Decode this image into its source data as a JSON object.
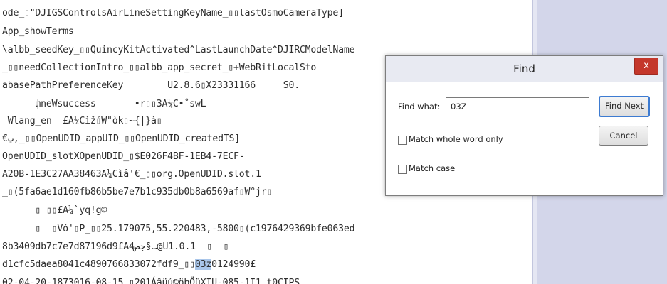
{
  "editor": {
    "lines": [
      "ode_▯\"DJIGSControlsAirLineSettingKeyName_▯▯lastOsmoCameraType]",
      "App_showTerms",
      "\\albb_seedKey_▯▯QuincyKitActivated^LastLaunchDate^DJIRCModelName",
      "_▯▯needCollectionIntro_▯▯albb_app_secret_▯+WebRitLocalSto",
      "abasePathPreferenceKey        U2.8.6▯X23331166     S0.",
      "      փneWsuccess       •r▯▯3A¼C•˚swL",
      " Wlang_en  £A¼Cìž́▯W\"òk▯~{|}à▯",
      "€پ,_▯▯OpenUDID_appUID_▯▯OpenUDID_createdTS]",
      "OpenUDID_slotXOpenUDID_▯$E026F4BF-1EB4-7ECF-",
      "A20B-1E3C27AA38463A¼Cìâ'€_▯▯org.OpenUDID.slot.1",
      "_▯(5fa6ae1d160fb86b5be7e7b1c935db0b8a6569af▯W°jr▯",
      "      ▯ ▯▯£A¼`yq!g©",
      "      ▯  ▯Vó'▯P_▯▯25.179075,55.220483,-5800▯(c1976429369bfe063ed",
      "8b3409db7c7e7d87196d9£A4جص§…@U1.0.1  ▯  ▯",
      "d1cfc5daea8041c4890766833072fdf9_▯▯",
      "02-04-20-1873016-08-15 ▯201Áâüú©öbÖüXIU-085-1I1 t0CIPS"
    ],
    "line14_highlight": "03z",
    "line14_tail": "0124990£"
  },
  "find_dialog": {
    "title": "Find",
    "close_glyph": "x",
    "find_what_label": "Find what:",
    "find_what_value": "03Z",
    "find_next_label": "Find Next",
    "cancel_label": "Cancel",
    "match_whole_word_label": "Match whole word only",
    "match_case_label": "Match case",
    "match_whole_word_checked": false,
    "match_case_checked": false
  }
}
